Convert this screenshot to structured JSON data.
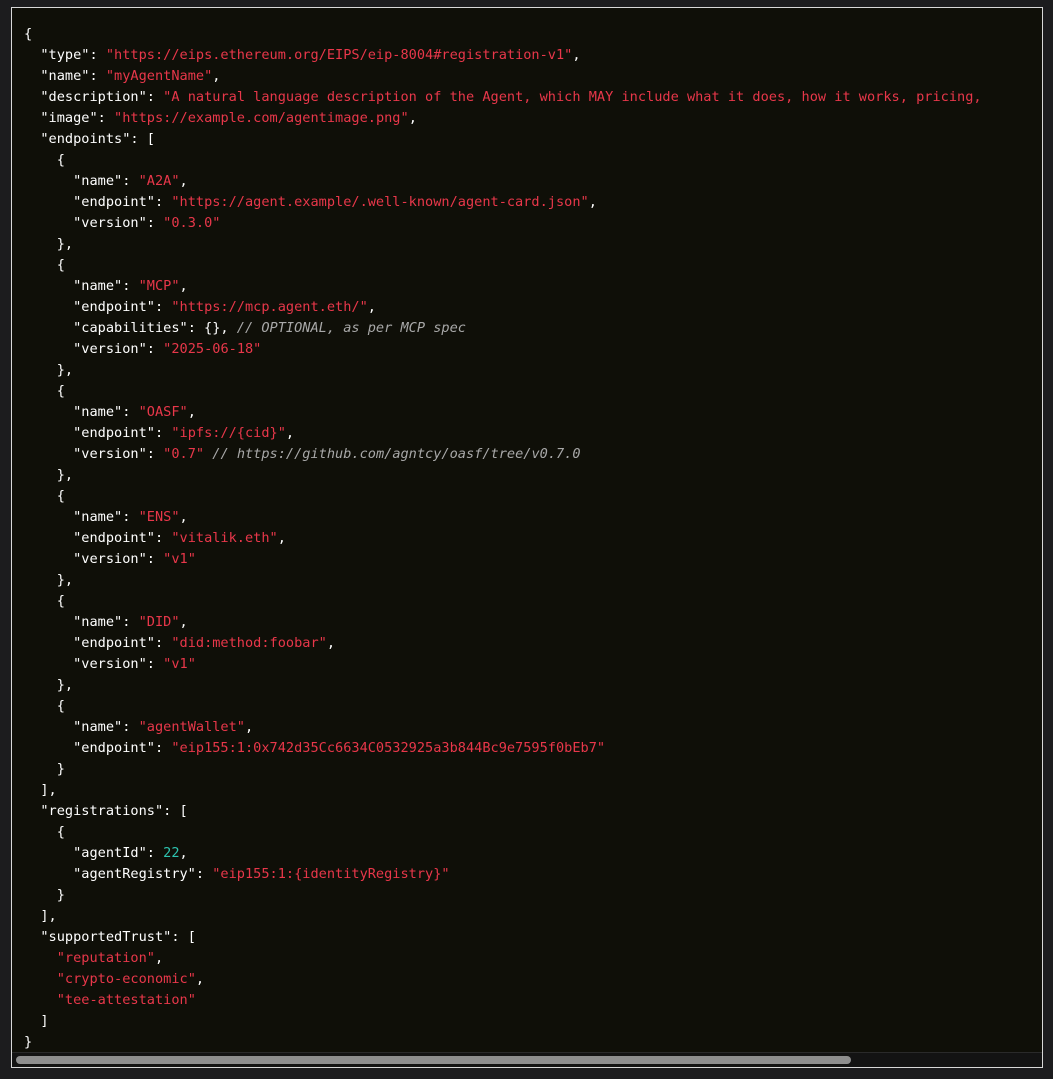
{
  "code": {
    "lines": [
      [
        {
          "t": "p",
          "v": "{"
        }
      ],
      [
        {
          "t": "p",
          "v": "  "
        },
        {
          "t": "k",
          "v": "\"type\""
        },
        {
          "t": "p",
          "v": ": "
        },
        {
          "t": "s",
          "v": "\"https://eips.ethereum.org/EIPS/eip-8004#registration-v1\""
        },
        {
          "t": "p",
          "v": ","
        }
      ],
      [
        {
          "t": "p",
          "v": "  "
        },
        {
          "t": "k",
          "v": "\"name\""
        },
        {
          "t": "p",
          "v": ": "
        },
        {
          "t": "s",
          "v": "\"myAgentName\""
        },
        {
          "t": "p",
          "v": ","
        }
      ],
      [
        {
          "t": "p",
          "v": "  "
        },
        {
          "t": "k",
          "v": "\"description\""
        },
        {
          "t": "p",
          "v": ": "
        },
        {
          "t": "s",
          "v": "\"A natural language description of the Agent, which MAY include what it does, how it works, pricing,"
        }
      ],
      [
        {
          "t": "p",
          "v": "  "
        },
        {
          "t": "k",
          "v": "\"image\""
        },
        {
          "t": "p",
          "v": ": "
        },
        {
          "t": "s",
          "v": "\"https://example.com/agentimage.png\""
        },
        {
          "t": "p",
          "v": ","
        }
      ],
      [
        {
          "t": "p",
          "v": "  "
        },
        {
          "t": "k",
          "v": "\"endpoints\""
        },
        {
          "t": "p",
          "v": ": ["
        }
      ],
      [
        {
          "t": "p",
          "v": "    {"
        }
      ],
      [
        {
          "t": "p",
          "v": "      "
        },
        {
          "t": "k",
          "v": "\"name\""
        },
        {
          "t": "p",
          "v": ": "
        },
        {
          "t": "s",
          "v": "\"A2A\""
        },
        {
          "t": "p",
          "v": ","
        }
      ],
      [
        {
          "t": "p",
          "v": "      "
        },
        {
          "t": "k",
          "v": "\"endpoint\""
        },
        {
          "t": "p",
          "v": ": "
        },
        {
          "t": "s",
          "v": "\"https://agent.example/.well-known/agent-card.json\""
        },
        {
          "t": "p",
          "v": ","
        }
      ],
      [
        {
          "t": "p",
          "v": "      "
        },
        {
          "t": "k",
          "v": "\"version\""
        },
        {
          "t": "p",
          "v": ": "
        },
        {
          "t": "s",
          "v": "\"0.3.0\""
        }
      ],
      [
        {
          "t": "p",
          "v": "    },"
        }
      ],
      [
        {
          "t": "p",
          "v": "    {"
        }
      ],
      [
        {
          "t": "p",
          "v": "      "
        },
        {
          "t": "k",
          "v": "\"name\""
        },
        {
          "t": "p",
          "v": ": "
        },
        {
          "t": "s",
          "v": "\"MCP\""
        },
        {
          "t": "p",
          "v": ","
        }
      ],
      [
        {
          "t": "p",
          "v": "      "
        },
        {
          "t": "k",
          "v": "\"endpoint\""
        },
        {
          "t": "p",
          "v": ": "
        },
        {
          "t": "s",
          "v": "\"https://mcp.agent.eth/\""
        },
        {
          "t": "p",
          "v": ","
        }
      ],
      [
        {
          "t": "p",
          "v": "      "
        },
        {
          "t": "k",
          "v": "\"capabilities\""
        },
        {
          "t": "p",
          "v": ": {}, "
        },
        {
          "t": "c",
          "v": "// OPTIONAL, as per MCP spec"
        }
      ],
      [
        {
          "t": "p",
          "v": "      "
        },
        {
          "t": "k",
          "v": "\"version\""
        },
        {
          "t": "p",
          "v": ": "
        },
        {
          "t": "s",
          "v": "\"2025-06-18\""
        }
      ],
      [
        {
          "t": "p",
          "v": "    },"
        }
      ],
      [
        {
          "t": "p",
          "v": "    {"
        }
      ],
      [
        {
          "t": "p",
          "v": "      "
        },
        {
          "t": "k",
          "v": "\"name\""
        },
        {
          "t": "p",
          "v": ": "
        },
        {
          "t": "s",
          "v": "\"OASF\""
        },
        {
          "t": "p",
          "v": ","
        }
      ],
      [
        {
          "t": "p",
          "v": "      "
        },
        {
          "t": "k",
          "v": "\"endpoint\""
        },
        {
          "t": "p",
          "v": ": "
        },
        {
          "t": "s",
          "v": "\"ipfs://{cid}\""
        },
        {
          "t": "p",
          "v": ","
        }
      ],
      [
        {
          "t": "p",
          "v": "      "
        },
        {
          "t": "k",
          "v": "\"version\""
        },
        {
          "t": "p",
          "v": ": "
        },
        {
          "t": "s",
          "v": "\"0.7\""
        },
        {
          "t": "p",
          "v": " "
        },
        {
          "t": "c",
          "v": "// https://github.com/agntcy/oasf/tree/v0.7.0"
        }
      ],
      [
        {
          "t": "p",
          "v": "    },"
        }
      ],
      [
        {
          "t": "p",
          "v": "    {"
        }
      ],
      [
        {
          "t": "p",
          "v": "      "
        },
        {
          "t": "k",
          "v": "\"name\""
        },
        {
          "t": "p",
          "v": ": "
        },
        {
          "t": "s",
          "v": "\"ENS\""
        },
        {
          "t": "p",
          "v": ","
        }
      ],
      [
        {
          "t": "p",
          "v": "      "
        },
        {
          "t": "k",
          "v": "\"endpoint\""
        },
        {
          "t": "p",
          "v": ": "
        },
        {
          "t": "s",
          "v": "\"vitalik.eth\""
        },
        {
          "t": "p",
          "v": ","
        }
      ],
      [
        {
          "t": "p",
          "v": "      "
        },
        {
          "t": "k",
          "v": "\"version\""
        },
        {
          "t": "p",
          "v": ": "
        },
        {
          "t": "s",
          "v": "\"v1\""
        }
      ],
      [
        {
          "t": "p",
          "v": "    },"
        }
      ],
      [
        {
          "t": "p",
          "v": "    {"
        }
      ],
      [
        {
          "t": "p",
          "v": "      "
        },
        {
          "t": "k",
          "v": "\"name\""
        },
        {
          "t": "p",
          "v": ": "
        },
        {
          "t": "s",
          "v": "\"DID\""
        },
        {
          "t": "p",
          "v": ","
        }
      ],
      [
        {
          "t": "p",
          "v": "      "
        },
        {
          "t": "k",
          "v": "\"endpoint\""
        },
        {
          "t": "p",
          "v": ": "
        },
        {
          "t": "s",
          "v": "\"did:method:foobar\""
        },
        {
          "t": "p",
          "v": ","
        }
      ],
      [
        {
          "t": "p",
          "v": "      "
        },
        {
          "t": "k",
          "v": "\"version\""
        },
        {
          "t": "p",
          "v": ": "
        },
        {
          "t": "s",
          "v": "\"v1\""
        }
      ],
      [
        {
          "t": "p",
          "v": "    },"
        }
      ],
      [
        {
          "t": "p",
          "v": "    {"
        }
      ],
      [
        {
          "t": "p",
          "v": "      "
        },
        {
          "t": "k",
          "v": "\"name\""
        },
        {
          "t": "p",
          "v": ": "
        },
        {
          "t": "s",
          "v": "\"agentWallet\""
        },
        {
          "t": "p",
          "v": ","
        }
      ],
      [
        {
          "t": "p",
          "v": "      "
        },
        {
          "t": "k",
          "v": "\"endpoint\""
        },
        {
          "t": "p",
          "v": ": "
        },
        {
          "t": "s",
          "v": "\"eip155:1:0x742d35Cc6634C0532925a3b844Bc9e7595f0bEb7\""
        }
      ],
      [
        {
          "t": "p",
          "v": "    }"
        }
      ],
      [
        {
          "t": "p",
          "v": "  ],"
        }
      ],
      [
        {
          "t": "p",
          "v": "  "
        },
        {
          "t": "k",
          "v": "\"registrations\""
        },
        {
          "t": "p",
          "v": ": ["
        }
      ],
      [
        {
          "t": "p",
          "v": "    {"
        }
      ],
      [
        {
          "t": "p",
          "v": "      "
        },
        {
          "t": "k",
          "v": "\"agentId\""
        },
        {
          "t": "p",
          "v": ": "
        },
        {
          "t": "n",
          "v": "22"
        },
        {
          "t": "p",
          "v": ","
        }
      ],
      [
        {
          "t": "p",
          "v": "      "
        },
        {
          "t": "k",
          "v": "\"agentRegistry\""
        },
        {
          "t": "p",
          "v": ": "
        },
        {
          "t": "s",
          "v": "\"eip155:1:{identityRegistry}\""
        }
      ],
      [
        {
          "t": "p",
          "v": "    }"
        }
      ],
      [
        {
          "t": "p",
          "v": "  ],"
        }
      ],
      [
        {
          "t": "p",
          "v": "  "
        },
        {
          "t": "k",
          "v": "\"supportedTrust\""
        },
        {
          "t": "p",
          "v": ": ["
        }
      ],
      [
        {
          "t": "p",
          "v": "    "
        },
        {
          "t": "s",
          "v": "\"reputation\""
        },
        {
          "t": "p",
          "v": ","
        }
      ],
      [
        {
          "t": "p",
          "v": "    "
        },
        {
          "t": "s",
          "v": "\"crypto-economic\""
        },
        {
          "t": "p",
          "v": ","
        }
      ],
      [
        {
          "t": "p",
          "v": "    "
        },
        {
          "t": "s",
          "v": "\"tee-attestation\""
        }
      ],
      [
        {
          "t": "p",
          "v": "  ]"
        }
      ],
      [
        {
          "t": "p",
          "v": "}"
        }
      ]
    ]
  },
  "scrollbar": {
    "horizontal_position": 0,
    "visible_fraction": 0.81
  },
  "colors": {
    "background": "#0f0f08",
    "key": "#ffffff",
    "string": "#e8374a",
    "number": "#2ec4b0",
    "comment": "#a8a8a8"
  }
}
